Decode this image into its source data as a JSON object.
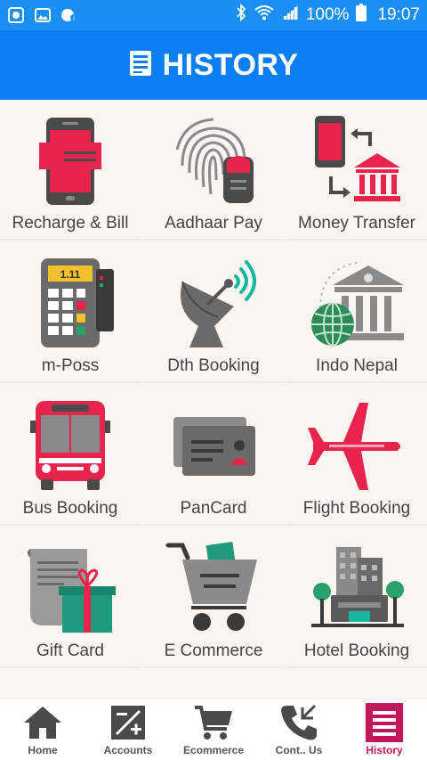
{
  "status_bar": {
    "battery": "100%",
    "time": "19:07"
  },
  "app_bar": {
    "title": "HISTORY"
  },
  "services": [
    {
      "label": "Recharge & Bill",
      "icon": "mobile-recharge-icon"
    },
    {
      "label": "Aadhaar Pay",
      "icon": "fingerprint-icon"
    },
    {
      "label": "Money Transfer",
      "icon": "money-transfer-icon"
    },
    {
      "label": "m-Poss",
      "icon": "pos-machine-icon"
    },
    {
      "label": "Dth Booking",
      "icon": "satellite-dish-icon"
    },
    {
      "label": "Indo Nepal",
      "icon": "bank-globe-icon"
    },
    {
      "label": "Bus Booking",
      "icon": "bus-icon"
    },
    {
      "label": "PanCard",
      "icon": "id-card-icon"
    },
    {
      "label": "Flight Booking",
      "icon": "airplane-icon"
    },
    {
      "label": "Gift Card",
      "icon": "gift-card-icon"
    },
    {
      "label": "E Commerce",
      "icon": "shopping-cart-icon"
    },
    {
      "label": "Hotel Booking",
      "icon": "hotel-building-icon"
    }
  ],
  "bottom_nav": {
    "items": [
      {
        "label": "Home",
        "icon": "home-icon"
      },
      {
        "label": "Accounts",
        "icon": "accounts-icon"
      },
      {
        "label": "Ecommerce",
        "icon": "cart-icon"
      },
      {
        "label": "Cont.. Us",
        "icon": "phone-icon"
      },
      {
        "label": "History",
        "icon": "history-icon"
      }
    ],
    "active": "History"
  },
  "colors": {
    "status_bar": "#1a8ff5",
    "app_bar": "#0a7ef3",
    "accent_red": "#e8244d",
    "grey_icon": "#5f5f5f",
    "active_nav": "#c2185b"
  }
}
